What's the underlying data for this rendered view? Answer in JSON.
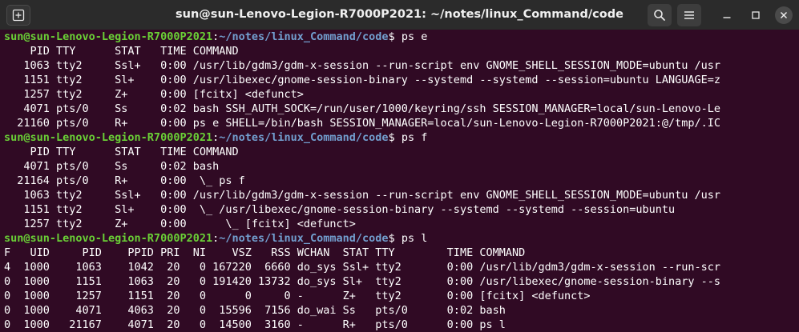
{
  "window": {
    "title": "sun@sun-Lenovo-Legion-R7000P2021: ~/notes/linux_Command/code"
  },
  "icons": {
    "new_tab": "new-tab-icon",
    "search": "search-icon",
    "menu": "hamburger-menu-icon",
    "minimize": "minimize-icon",
    "maximize": "maximize-icon",
    "close": "close-icon"
  },
  "colors": {
    "background": "#300a24",
    "titlebar": "#2b2b2b",
    "prompt_user": "#6ad036",
    "prompt_path": "#729fcf",
    "text": "#ffffff"
  },
  "terminal": {
    "lines": [
      {
        "type": "prompt",
        "user": "sun@sun-Lenovo-Legion-R7000P2021",
        "colon": ":",
        "path": "~/notes/linux_Command/code",
        "dollar": "$ ",
        "command": "ps e"
      },
      {
        "type": "output",
        "text": "    PID TTY      STAT   TIME COMMAND"
      },
      {
        "type": "output",
        "text": "   1063 tty2     Ssl+   0:00 /usr/lib/gdm3/gdm-x-session --run-script env GNOME_SHELL_SESSION_MODE=ubuntu /usr"
      },
      {
        "type": "output",
        "text": "   1151 tty2     Sl+    0:00 /usr/libexec/gnome-session-binary --systemd --systemd --session=ubuntu LANGUAGE=z"
      },
      {
        "type": "output",
        "text": "   1257 tty2     Z+     0:00 [fcitx] <defunct>"
      },
      {
        "type": "output",
        "text": "   4071 pts/0    Ss     0:02 bash SSH_AUTH_SOCK=/run/user/1000/keyring/ssh SESSION_MANAGER=local/sun-Lenovo-Le"
      },
      {
        "type": "output",
        "text": "  21160 pts/0    R+     0:00 ps e SHELL=/bin/bash SESSION_MANAGER=local/sun-Lenovo-Legion-R7000P2021:@/tmp/.IC"
      },
      {
        "type": "prompt",
        "user": "sun@sun-Lenovo-Legion-R7000P2021",
        "colon": ":",
        "path": "~/notes/linux_Command/code",
        "dollar": "$ ",
        "command": "ps f"
      },
      {
        "type": "output",
        "text": "    PID TTY      STAT   TIME COMMAND"
      },
      {
        "type": "output",
        "text": "   4071 pts/0    Ss     0:02 bash"
      },
      {
        "type": "output",
        "text": "  21164 pts/0    R+     0:00  \\_ ps f"
      },
      {
        "type": "output",
        "text": "   1063 tty2     Ssl+   0:00 /usr/lib/gdm3/gdm-x-session --run-script env GNOME_SHELL_SESSION_MODE=ubuntu /usr"
      },
      {
        "type": "output",
        "text": "   1151 tty2     Sl+    0:00  \\_ /usr/libexec/gnome-session-binary --systemd --systemd --session=ubuntu"
      },
      {
        "type": "output",
        "text": "   1257 tty2     Z+     0:00      \\_ [fcitx] <defunct>"
      },
      {
        "type": "prompt",
        "user": "sun@sun-Lenovo-Legion-R7000P2021",
        "colon": ":",
        "path": "~/notes/linux_Command/code",
        "dollar": "$ ",
        "command": "ps l"
      },
      {
        "type": "output",
        "text": "F   UID     PID    PPID PRI  NI    VSZ   RSS WCHAN  STAT TTY        TIME COMMAND"
      },
      {
        "type": "output",
        "text": "4  1000    1063    1042  20   0 167220  6660 do_sys Ssl+ tty2       0:00 /usr/lib/gdm3/gdm-x-session --run-scr"
      },
      {
        "type": "output",
        "text": "0  1000    1151    1063  20   0 191420 13732 do_sys Sl+  tty2       0:00 /usr/libexec/gnome-session-binary --s"
      },
      {
        "type": "output",
        "text": "0  1000    1257    1151  20   0      0     0 -      Z+   tty2       0:00 [fcitx] <defunct>"
      },
      {
        "type": "output",
        "text": "0  1000    4071    4063  20   0  15596  7156 do_wai Ss   pts/0      0:02 bash"
      },
      {
        "type": "output",
        "text": "0  1000   21167    4071  20   0  14500  3160 -      R+   pts/0      0:00 ps l"
      }
    ]
  }
}
